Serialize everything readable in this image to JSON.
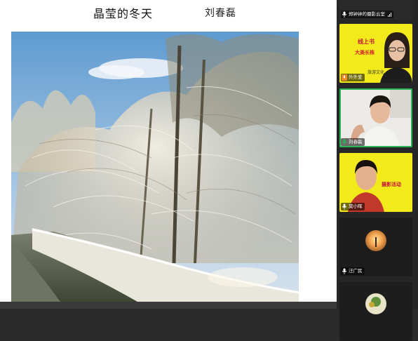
{
  "slide": {
    "title": "晶莹的冬天",
    "author": "刘春磊"
  },
  "participants": [
    {
      "name": "郑钟钟的摄影云室",
      "muted": false,
      "signal": true
    },
    {
      "name": "外外爱",
      "muted": false,
      "poster_line1": "线上书",
      "poster_line2": "大美长株",
      "poster_line3": "旅游文化"
    },
    {
      "name": "刘春磊",
      "muted": false,
      "active": true
    },
    {
      "name": "莫小晖",
      "muted": false,
      "poster_line1": "摄影活动"
    },
    {
      "name": "汪广民",
      "muted": false
    },
    {
      "name": "",
      "muted": false
    }
  ],
  "colors": {
    "sidebar_bg": "#262626",
    "active_border": "#2ab55a",
    "poster_yellow": "#f2ea1a",
    "mic_green": "#2ab55a",
    "mic_orange": "#f08a24"
  }
}
